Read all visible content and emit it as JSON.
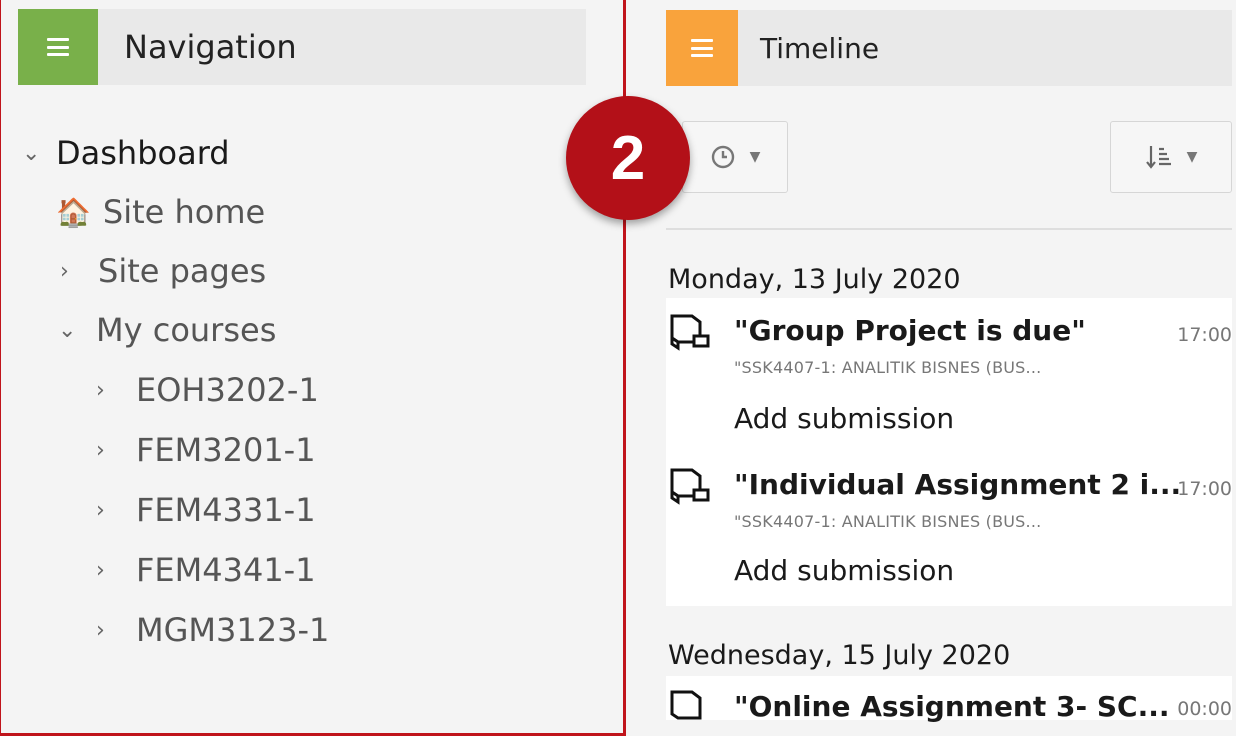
{
  "navigation": {
    "title": "Navigation",
    "dashboard": "Dashboard",
    "site_home": "Site home",
    "site_pages": "Site pages",
    "my_courses": "My courses",
    "courses": [
      "EOH3202-1",
      "FEM3201-1",
      "FEM4331-1",
      "FEM4341-1",
      "MGM3123-1"
    ]
  },
  "step_badge": "2",
  "timeline": {
    "title": "Timeline",
    "days": [
      {
        "date": "Monday, 13 July 2020",
        "events": [
          {
            "name": "\"Group Project is due\"",
            "time": "17:00",
            "course": "\"SSK4407-1: ANALITIK BISNES (BUS...",
            "action": "Add submission"
          },
          {
            "name": "\"Individual Assignment 2 i...",
            "time": "17:00",
            "course": "\"SSK4407-1: ANALITIK BISNES (BUS...",
            "action": "Add submission"
          }
        ]
      },
      {
        "date": "Wednesday, 15 July 2020",
        "events": [
          {
            "name": "\"Online Assignment 3- SC...",
            "time": "00:00"
          }
        ]
      }
    ]
  },
  "colors": {
    "navigation_accent": "#79b04a",
    "timeline_accent": "#f9a33c",
    "highlight": "#c0141b",
    "badge": "#b31018"
  }
}
